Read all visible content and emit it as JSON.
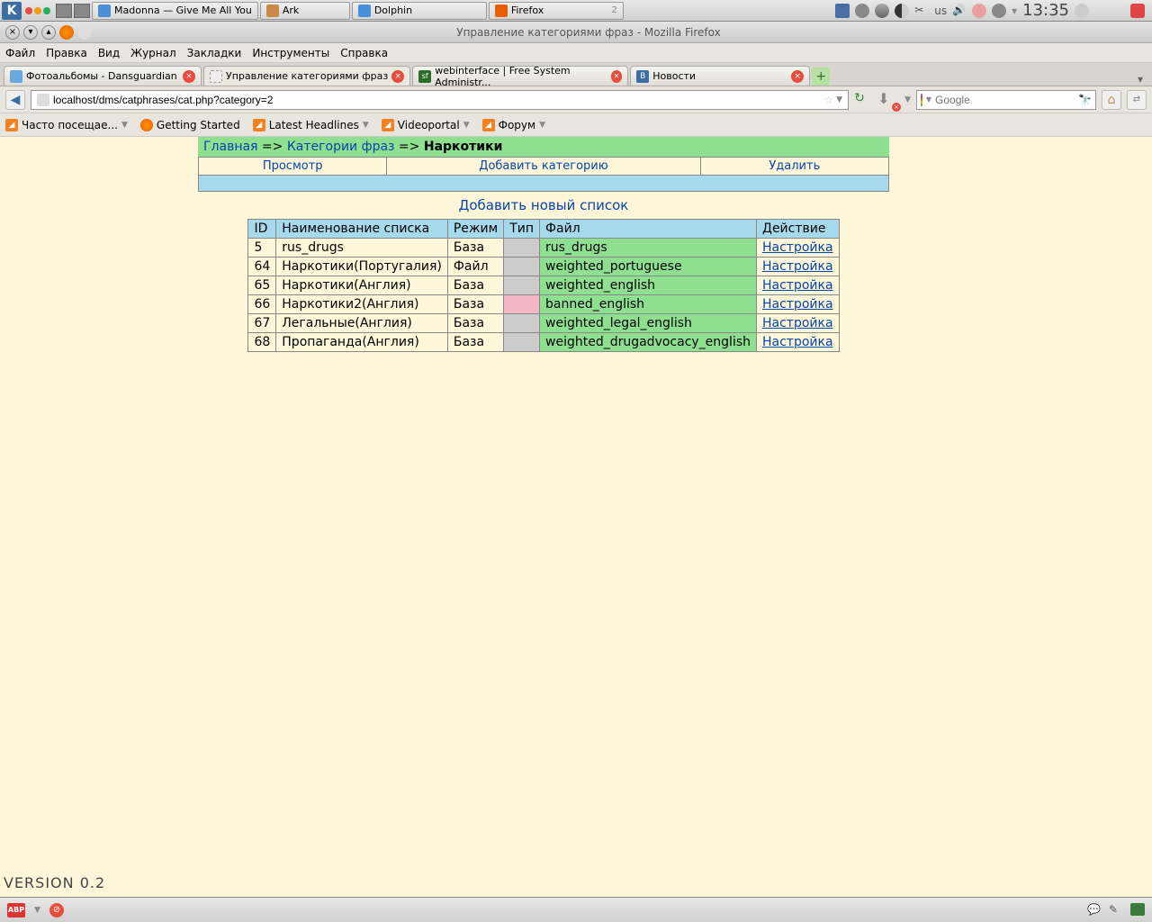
{
  "taskbar": {
    "apps": [
      {
        "label": "Madonna — Give Me All You",
        "color": "#4a90d9"
      },
      {
        "label": "Ark",
        "color": "#c9894a"
      },
      {
        "label": "Dolphin",
        "color": "#4a90d9"
      },
      {
        "label": "Firefox",
        "color": "#e66000"
      }
    ],
    "lang": "us",
    "time": "13:35"
  },
  "window": {
    "title": "Управление категориями фраз - Mozilla Firefox"
  },
  "menu": [
    "Файл",
    "Правка",
    "Вид",
    "Журнал",
    "Закладки",
    "Инструменты",
    "Справка"
  ],
  "tabs": [
    {
      "label": "Фотоальбомы - Dansguardian",
      "icon": "#6aa6e0"
    },
    {
      "label": "Управление категориями фраз",
      "icon": "#ccc",
      "active": true
    },
    {
      "label": "webinterface | Free System Administr...",
      "icon": "#2a6e2a"
    },
    {
      "label": "Новости",
      "icon": "#3b6ea5"
    }
  ],
  "url": "localhost/dms/catphrases/cat.php?category=2",
  "search": {
    "placeholder": "Google"
  },
  "bookmarks": [
    {
      "label": "Часто посещае...",
      "type": "rss"
    },
    {
      "label": "Getting Started",
      "type": "ff"
    },
    {
      "label": "Latest Headlines",
      "type": "rss"
    },
    {
      "label": "Videoportal",
      "type": "rss"
    },
    {
      "label": "Форум",
      "type": "rss"
    }
  ],
  "breadcrumb": {
    "home": "Главная",
    "sep": " => ",
    "categories": "Категории фраз",
    "current": "Наркотики"
  },
  "actions": {
    "view": "Просмотр",
    "add": "Добавить категорию",
    "del": "Удалить"
  },
  "add_list": "Добавить новый список",
  "table": {
    "headers": {
      "id": "ID",
      "name": "Наименование списка",
      "mode": "Режим",
      "type": "Тип",
      "file": "Файл",
      "action": "Действие"
    },
    "rows": [
      {
        "id": "5",
        "name": "rus_drugs",
        "mode": "База",
        "type": "grey",
        "file": "rus_drugs",
        "action": "Настройка"
      },
      {
        "id": "64",
        "name": "Наркотики(Португалия)",
        "mode": "Файл",
        "type": "grey",
        "file": "weighted_portuguese",
        "action": "Настройка"
      },
      {
        "id": "65",
        "name": "Наркотики(Англия)",
        "mode": "База",
        "type": "grey",
        "file": "weighted_english",
        "action": "Настройка"
      },
      {
        "id": "66",
        "name": "Наркотики2(Англия)",
        "mode": "База",
        "type": "pink",
        "file": "banned_english",
        "action": "Настройка"
      },
      {
        "id": "67",
        "name": "Легальные(Англия)",
        "mode": "База",
        "type": "grey",
        "file": "weighted_legal_english",
        "action": "Настройка"
      },
      {
        "id": "68",
        "name": "Пропаганда(Англия)",
        "mode": "База",
        "type": "grey",
        "file": "weighted_drugadvocacy_english",
        "action": "Настройка"
      }
    ]
  },
  "version": "VERSION 0.2"
}
